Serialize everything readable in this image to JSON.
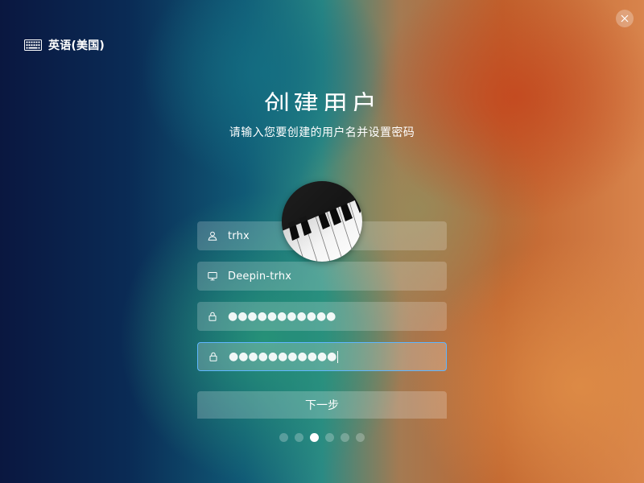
{
  "keyboard_layout": {
    "icon": "keyboard-icon",
    "label": "英语(美国)"
  },
  "close_icon": "close-icon",
  "title": "创建用户",
  "subtitle": "请输入您要创建的用户名并设置密码",
  "avatar": {
    "image": "piano-keys"
  },
  "fields": {
    "username": {
      "icon": "user-icon",
      "value": "trhx"
    },
    "hostname": {
      "icon": "computer-icon",
      "value": "Deepin-trhx"
    },
    "password": {
      "icon": "lock-icon",
      "masked": "●●●●●●●●●●●"
    },
    "password_confirm": {
      "icon": "lock-icon",
      "masked": "●●●●●●●●●●●",
      "focused": true
    }
  },
  "next_button": {
    "label": "下一步"
  },
  "pager": {
    "total": 6,
    "active_index": 2
  },
  "colors": {
    "focus_border": "#5fb6ff",
    "text": "#ffffff"
  }
}
